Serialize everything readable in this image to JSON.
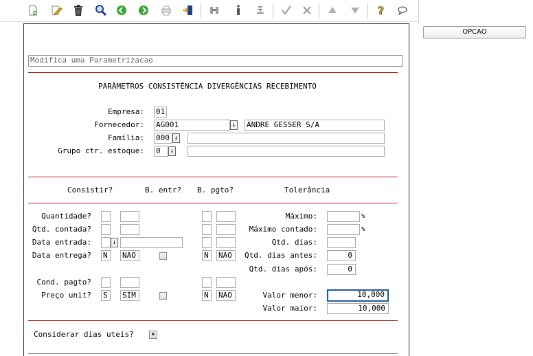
{
  "toolbar": {
    "icons": [
      "new-document-icon",
      "edit-icon",
      "delete-icon",
      "search-icon",
      "previous-icon",
      "next-icon",
      "print-icon",
      "exit-icon",
      "binoculars-icon",
      "info-icon",
      "list-icon",
      "confirm-icon",
      "cancel-icon",
      "up-icon",
      "down-icon",
      "help-icon",
      "chat-icon"
    ]
  },
  "side": {
    "opcao_label": "OPCAO"
  },
  "form": {
    "title_field_placeholder": "Modifica uma Parametrizacao",
    "section_title": "PARÂMETROS CONSISTÊNCIA DIVERGÊNCIAS RECEBIMENTO",
    "empresa": {
      "label": "Empresa:",
      "value": "01"
    },
    "fornecedor": {
      "label": "Fornecedor:",
      "code": "AG001",
      "name": "ANDRE GESSER S/A"
    },
    "familia": {
      "label": "Família:",
      "code": "000",
      "name": ""
    },
    "grupo": {
      "label": "Grupo ctr. estoque:",
      "code": "0",
      "name": ""
    },
    "headers": {
      "consistir": "Consistir?",
      "b_entr": "B. entr?",
      "b_pgto": "B. pgto?",
      "tolerancia": "Tolerância"
    },
    "rows": {
      "quantidade": {
        "label": "Quantidade?",
        "flag": "",
        "text": "",
        "pgto_flag": "",
        "pgto_text": ""
      },
      "qtd_contada": {
        "label": "Qtd. contada?",
        "flag": "",
        "text": "",
        "pgto_flag": "",
        "pgto_text": ""
      },
      "data_entrada": {
        "label": "Data entrada:",
        "value": "",
        "pgto_flag": "",
        "pgto_text": ""
      },
      "data_entrega": {
        "label": "Data entrega?",
        "flag": "N",
        "text": "NAO",
        "pgto_flag": "N",
        "pgto_text": "NAO"
      },
      "cond_pagto": {
        "label": "Cond. pagto?",
        "flag": "",
        "text": "",
        "pgto_flag": "",
        "pgto_text": ""
      },
      "preco_unit": {
        "label": "Preço unit?",
        "flag": "S",
        "text": "SIM",
        "pgto_flag": "N",
        "pgto_text": "NAO"
      }
    },
    "tolerance": {
      "maximo": {
        "label": "Máximo:",
        "value": "",
        "unit": "%"
      },
      "maximo_contado": {
        "label": "Máximo contado:",
        "value": "",
        "unit": "%"
      },
      "qtd_dias": {
        "label": "Qtd. dias:",
        "value": ""
      },
      "qtd_dias_antes": {
        "label": "Qtd. dias antes:",
        "value": "0"
      },
      "qtd_dias_apos": {
        "label": "Qtd. dias após:",
        "value": "0"
      },
      "valor_menor": {
        "label": "Valor menor:",
        "value": "10,000"
      },
      "valor_maior": {
        "label": "Valor maior:",
        "value": "10,000"
      }
    },
    "dias_uteis": {
      "label": "Considerar dias uteis?",
      "checked": true
    }
  }
}
